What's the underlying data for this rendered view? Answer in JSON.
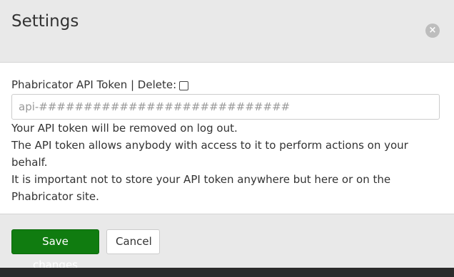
{
  "dialog": {
    "title": "Settings",
    "close_icon": "close-icon",
    "close_glyph": "×"
  },
  "form": {
    "token_label": "Phabricator API Token | Delete:",
    "delete_checked": false,
    "token_input": {
      "value": "",
      "placeholder": "api-############################"
    },
    "help_lines": [
      "Your API token will be removed on log out.",
      "The API token allows anybody with access to it to perform actions on your behalf.",
      "It is important not to store your API token anywhere but here or on the",
      "Phabricator site."
    ]
  },
  "footer": {
    "save_label": "Save changes",
    "cancel_label": "Cancel"
  },
  "colors": {
    "primary_button": "#107c10",
    "header_bg": "#e9e9e9",
    "close_icon_bg": "#bdbdbd"
  }
}
